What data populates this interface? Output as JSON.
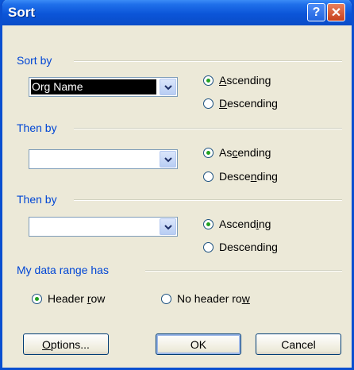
{
  "window": {
    "title": "Sort",
    "help_icon": "?",
    "close_icon": "✕"
  },
  "sort_by": {
    "label": "Sort by",
    "field_value": "Org Name",
    "ascending": {
      "pre": "",
      "key": "A",
      "post": "scending",
      "checked": true
    },
    "descending": {
      "pre": "",
      "key": "D",
      "post": "escending",
      "checked": false
    }
  },
  "then_by_1": {
    "label": "Then by",
    "field_value": "",
    "ascending": {
      "pre": "As",
      "key": "c",
      "post": "ending",
      "checked": true
    },
    "descending": {
      "pre": "Desce",
      "key": "n",
      "post": "ding",
      "checked": false
    }
  },
  "then_by_2": {
    "label": "Then by",
    "field_value": "",
    "ascending": {
      "pre": "Ascend",
      "key": "i",
      "post": "ng",
      "checked": true
    },
    "descending": {
      "pre": "Descendin",
      "key": "g",
      "post": "",
      "checked": false
    }
  },
  "data_range": {
    "label": "My data range has",
    "header_row": {
      "pre": "Header ",
      "key": "r",
      "post": "ow",
      "checked": true
    },
    "no_header_row": {
      "pre": "No header ro",
      "key": "w",
      "post": "",
      "checked": false
    }
  },
  "buttons": {
    "options": {
      "pre": "",
      "key": "O",
      "post": "ptions..."
    },
    "ok": "OK",
    "cancel": "Cancel"
  }
}
